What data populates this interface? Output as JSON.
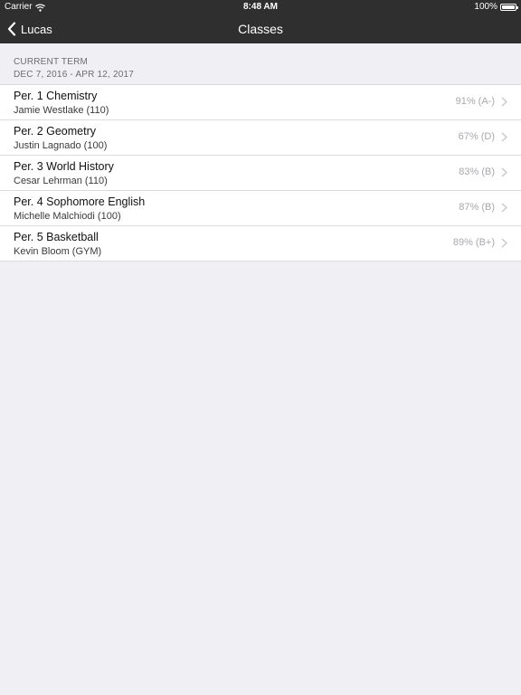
{
  "status_bar": {
    "carrier": "Carrier",
    "time": "8:48 AM",
    "battery": "100%"
  },
  "nav": {
    "back_label": "Lucas",
    "title": "Classes"
  },
  "term": {
    "label": "CURRENT TERM",
    "dates": "DEC 7, 2016 - APR 12, 2017"
  },
  "classes": [
    {
      "name": "Per. 1 Chemistry",
      "teacher": "Jamie Westlake (110)",
      "grade": "91% (A-)"
    },
    {
      "name": "Per. 2 Geometry",
      "teacher": "Justin Lagnado (100)",
      "grade": "67% (D)"
    },
    {
      "name": "Per. 3 World History",
      "teacher": "Cesar Lehrman (110)",
      "grade": "83% (B)"
    },
    {
      "name": "Per. 4 Sophomore English",
      "teacher": "Michelle Malchiodi (100)",
      "grade": "87% (B)"
    },
    {
      "name": "Per. 5 Basketball",
      "teacher": "Kevin Bloom (GYM)",
      "grade": "89% (B+)"
    }
  ],
  "colors": {
    "nav_background": "#2f2f2f",
    "page_background": "#efeff4",
    "grade_text": "#a8a8ad"
  }
}
